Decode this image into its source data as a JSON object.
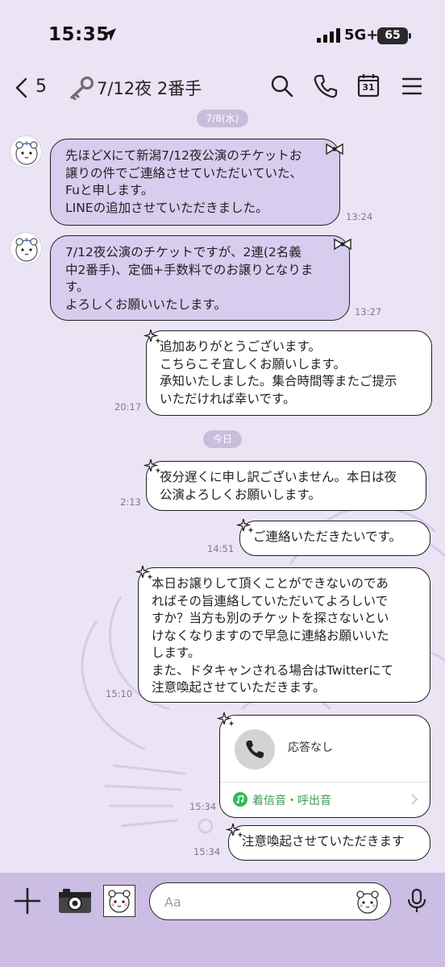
{
  "status_bar": {
    "time": "15:35",
    "network": "5G+",
    "battery": "65"
  },
  "header": {
    "back_count": "5",
    "title": "7/12夜 2番手",
    "icons": [
      "search-icon",
      "phone-icon",
      "calendar-icon",
      "menu-icon"
    ],
    "calendar_day": "31"
  },
  "messages": {
    "date1": "7/8(水)",
    "m1": {
      "text": "先ほどXにて新潟7/12夜公演のチケットお\n譲りの件でご連絡させていただいていた、\nFuと申します。\nLINEの追加させていただきました。",
      "time": "13:24"
    },
    "m2": {
      "text": "7/12夜公演のチケットですが、2連(2名義\n中2番手)、定価+手数料でのお譲りとなりま\nす。\nよろしくお願いいたします。",
      "time": "13:27"
    },
    "m3": {
      "text": "追加ありがとうございます。\nこちらこそ宜しくお願いします。\n承知いたしました。集合時間等またご提示\nいただければ幸いです。",
      "time": "20:17"
    },
    "date2": "今日",
    "m4": {
      "text": "夜分遅くに申し訳ございません。本日は夜\n公演よろしくお願いします。",
      "time": "2:13"
    },
    "m5": {
      "text": "ご連絡いただきたいです。",
      "time": "14:51"
    },
    "m6": {
      "text": "本日お譲りして頂くことができないのであ\nればその旨連絡していただいてよろしいで\nすか？当方も別のチケットを探さないとい\nけなくなりますので早急に連絡お願いいた\nします。\nまた、ドタキャンされる場合はTwitterにて\n注意喚起させていただきます。",
      "time": "15:10"
    },
    "call": {
      "status": "応答なし",
      "ringtone": "着信音・呼出音",
      "time": "15:34"
    },
    "m7": {
      "text": "注意喚起させていただきます",
      "time": "15:34"
    }
  },
  "input": {
    "placeholder": "Aa"
  },
  "colors": {
    "background": "#ebe4f5",
    "received_bubble": "#d7cdef",
    "sent_bubble": "#ffffff",
    "input_bar": "#cbbde3",
    "ringtone_green": "#3a9b4c"
  }
}
